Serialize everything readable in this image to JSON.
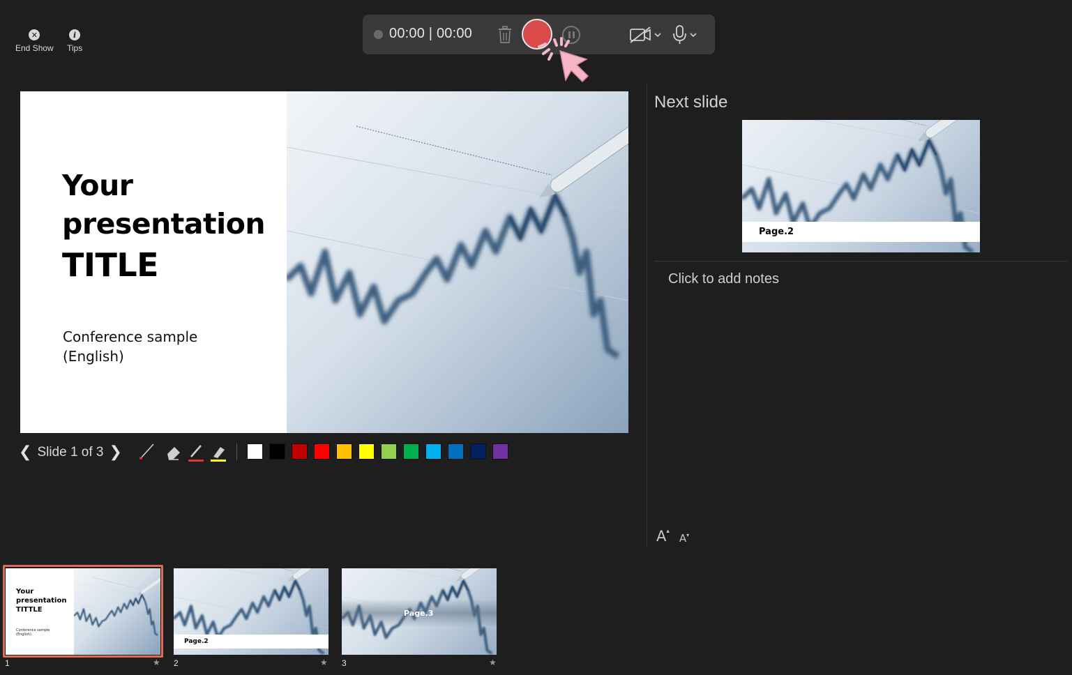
{
  "controls": {
    "end_show": "End Show",
    "tips": "Tips"
  },
  "recording": {
    "timer": "00:00 | 00:00"
  },
  "slide": {
    "title_line1": "Your",
    "title_line2": "presentation",
    "title_line3": "TITLE",
    "subtitle": "Conference sample (English)"
  },
  "navigation": {
    "label": "Slide 1 of 3"
  },
  "ink_colors": [
    "#ffffff",
    "#000000",
    "#c00000",
    "#ff0000",
    "#ffc000",
    "#ffff00",
    "#92d050",
    "#00b050",
    "#00b0f0",
    "#0070c0",
    "#002060",
    "#7030a0"
  ],
  "next_slide": {
    "label": "Next slide",
    "thumb_caption": "Page.2"
  },
  "notes": {
    "placeholder": "Click to add notes"
  },
  "thumbnails": [
    {
      "number": "1",
      "title_line1": "Your",
      "title_line2": "presentation",
      "title_line3": "TITTLE",
      "subtitle": "Conference sample (English)"
    },
    {
      "number": "2",
      "caption": "Page.2"
    },
    {
      "number": "3",
      "caption": "Page.3"
    }
  ],
  "star_glyph": "★",
  "accent_color": "#e06a52",
  "record_color": "#d94a4a"
}
